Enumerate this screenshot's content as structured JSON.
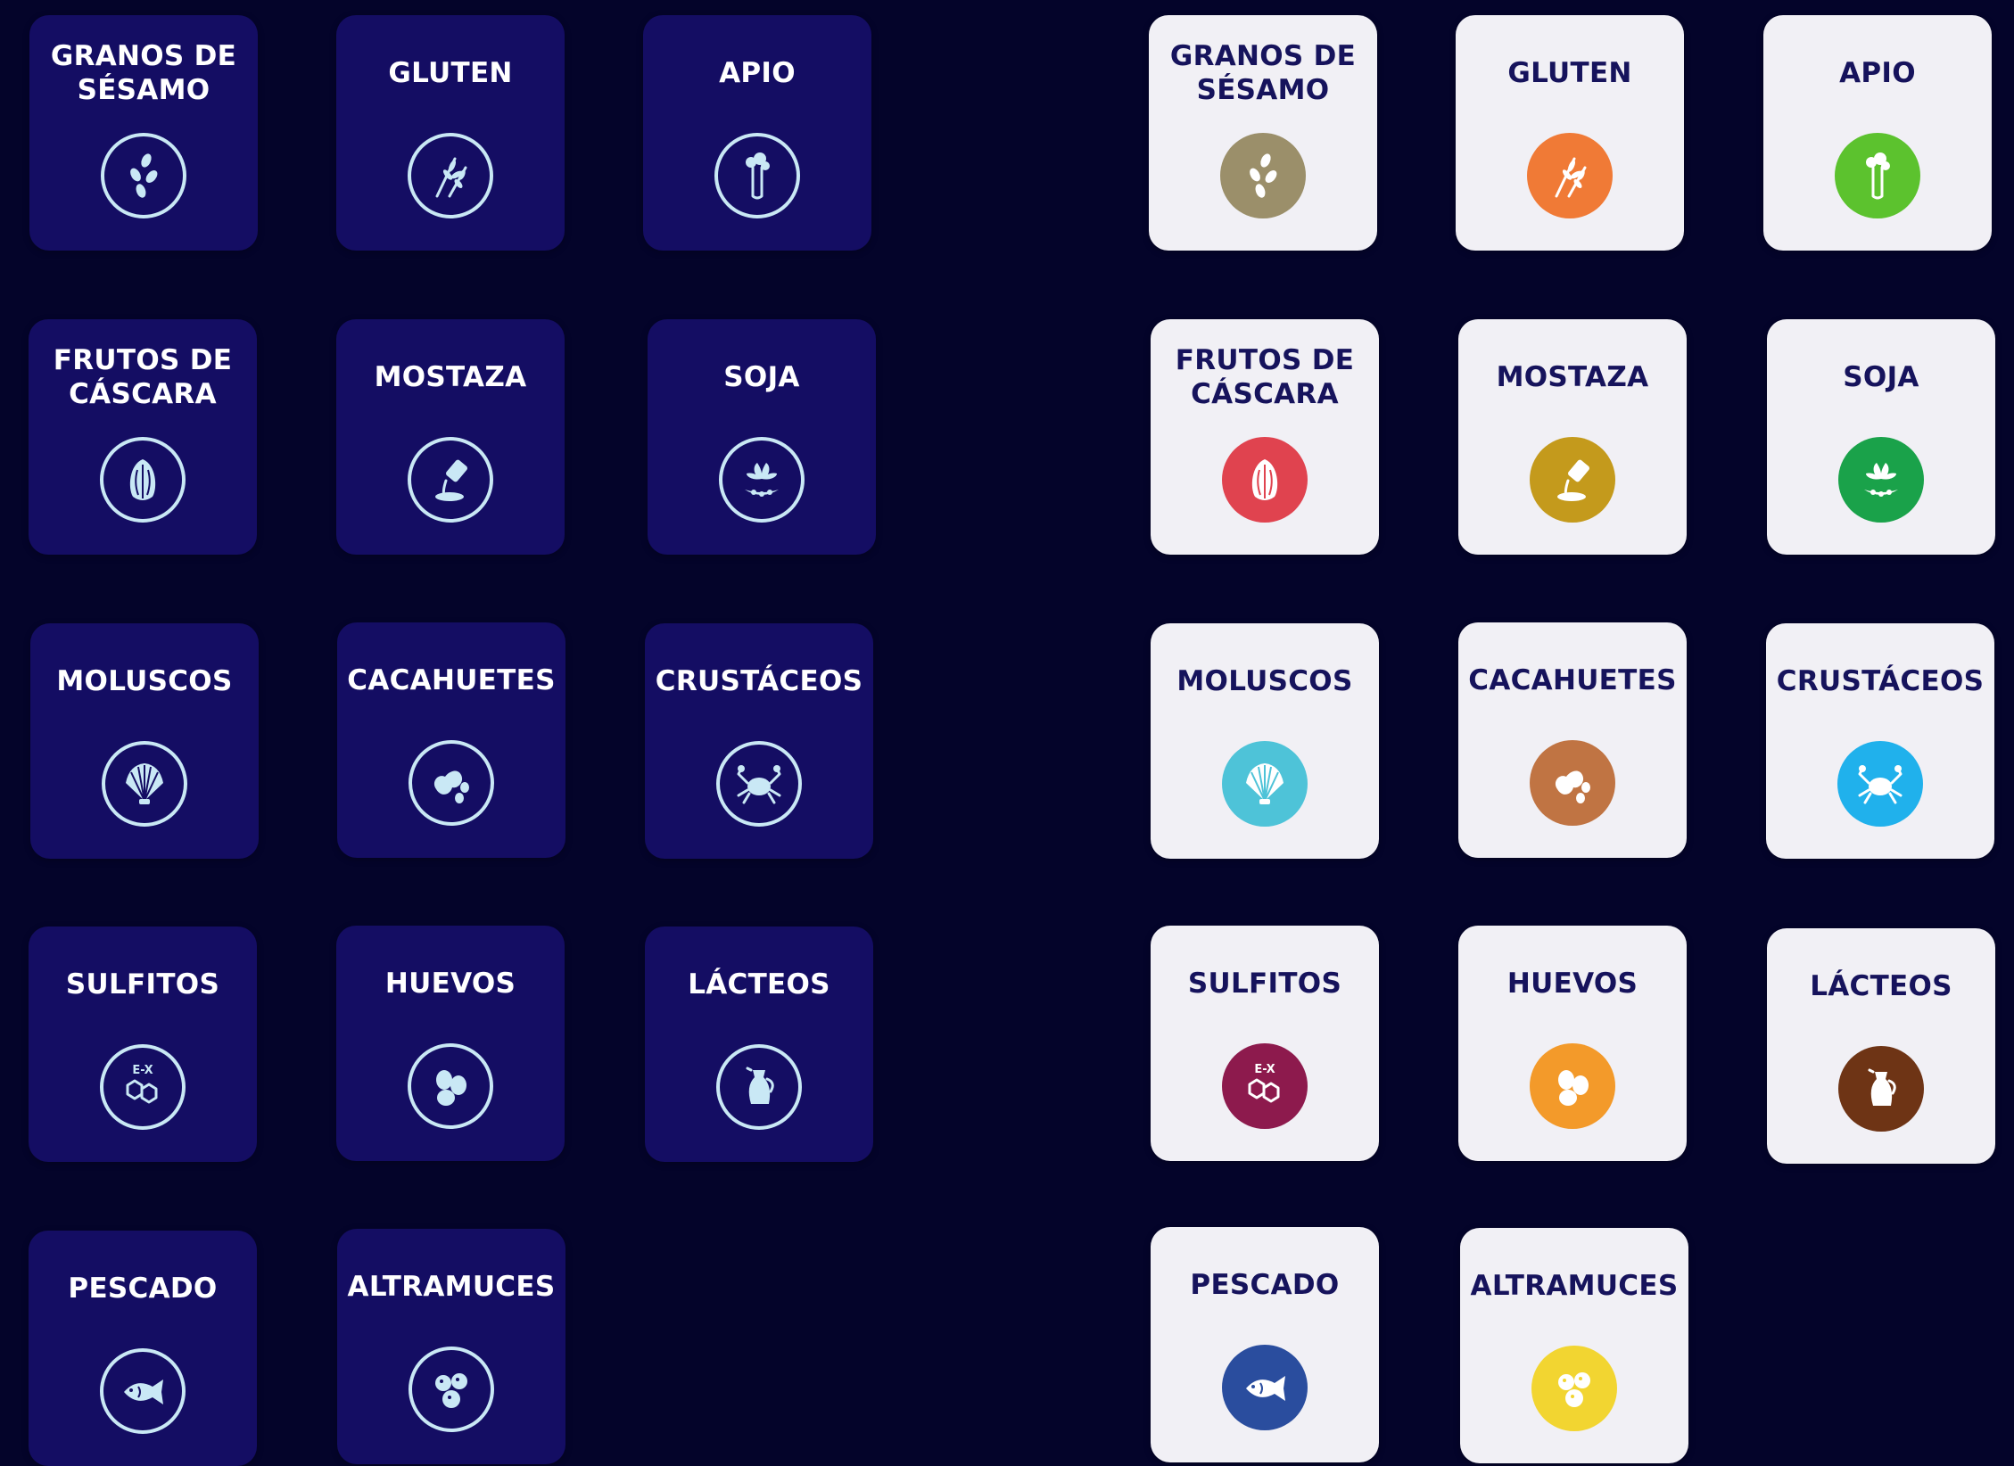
{
  "colors": {
    "page_bg": "#04042a",
    "dark_tile_bg": "#140d63",
    "light_tile_bg": "#f1f0f5",
    "dark_icon_stroke": "#c9e8f5",
    "light_label": "#16135c"
  },
  "allergens": [
    {
      "label": "GRANOS DE SÉSAMO",
      "icon": "sesame-icon",
      "color": "#9b8f6a"
    },
    {
      "label": "GLUTEN",
      "icon": "wheat-icon",
      "color": "#f07a36"
    },
    {
      "label": "APIO",
      "icon": "celery-icon",
      "color": "#5cc22e"
    },
    {
      "label": "FRUTOS DE CÁSCARA",
      "icon": "nut-icon",
      "color": "#e0434f"
    },
    {
      "label": "MOSTAZA",
      "icon": "mustard-icon",
      "color": "#c49a1c"
    },
    {
      "label": "SOJA",
      "icon": "soy-icon",
      "color": "#1aa24a"
    },
    {
      "label": "MOLUSCOS",
      "icon": "shell-icon",
      "color": "#4ec3d8"
    },
    {
      "label": "CACAHUETES",
      "icon": "peanut-icon",
      "color": "#c07443"
    },
    {
      "label": "CRUSTÁCEOS",
      "icon": "crab-icon",
      "color": "#20b1ec"
    },
    {
      "label": "SULFITOS",
      "icon": "sulfite-icon",
      "color": "#8d1a4d",
      "sub": "E-X"
    },
    {
      "label": "HUEVOS",
      "icon": "eggs-icon",
      "color": "#f39a2a"
    },
    {
      "label": "LÁCTEOS",
      "icon": "milk-jug-icon",
      "color": "#6e3415"
    },
    {
      "label": "PESCADO",
      "icon": "fish-icon",
      "color": "#2a4d9e"
    },
    {
      "label": "ALTRAMUCES",
      "icon": "lupin-icon",
      "color": "#f2d531"
    }
  ]
}
